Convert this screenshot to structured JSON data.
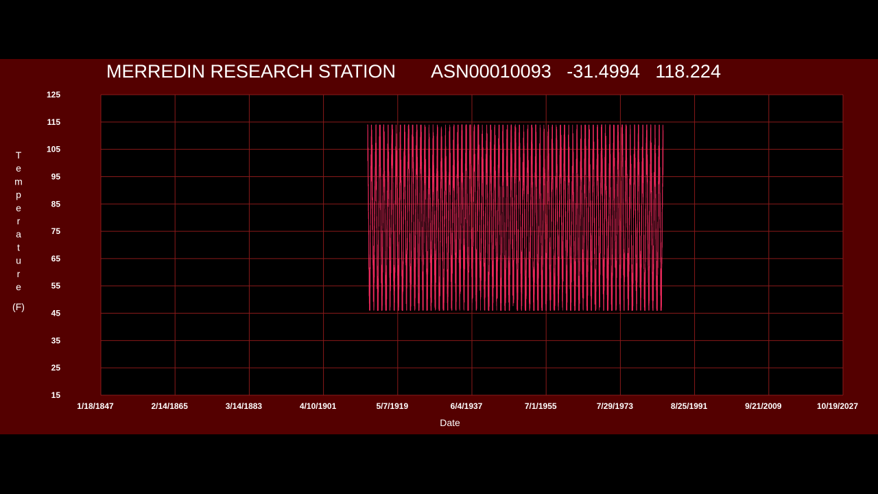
{
  "title": {
    "station": "MERREDIN RESEARCH STATION",
    "id": "ASN00010093",
    "lat": "-31.4994",
    "lon": "118.224"
  },
  "colors": {
    "background": "#000000",
    "panel": "#540000",
    "plot_area": "#000000",
    "grid": "#8b1a1a",
    "series": "#e8285a",
    "text": "#ffffff"
  },
  "chart_data": {
    "type": "line",
    "xlabel": "Date",
    "ylabel_chars": [
      "T",
      "e",
      "m",
      "p",
      "e",
      "r",
      "a",
      "t",
      "u",
      "r",
      "e"
    ],
    "ylabel_unit": "(F)",
    "ylim": [
      15,
      125
    ],
    "yticks": [
      125,
      115,
      105,
      95,
      85,
      75,
      65,
      55,
      45,
      35,
      25,
      15
    ],
    "xticks": [
      "1/18/1847",
      "2/14/1865",
      "3/14/1883",
      "4/10/1901",
      "5/7/1919",
      "6/4/1937",
      "7/1/1955",
      "7/29/1973",
      "8/25/1991",
      "9/21/2009",
      "10/19/2027"
    ],
    "xlim": [
      "1847-01-18",
      "2027-10-19"
    ],
    "grid": true,
    "series": [
      {
        "x_start": "1912-01-01",
        "x_end": "1984-01-01",
        "annual_max_range": [
          103,
          114
        ],
        "annual_min_range": [
          46,
          55
        ],
        "description_of_values": "daily temperatures oscillating seasonally between about 50 and 110"
      }
    ]
  }
}
